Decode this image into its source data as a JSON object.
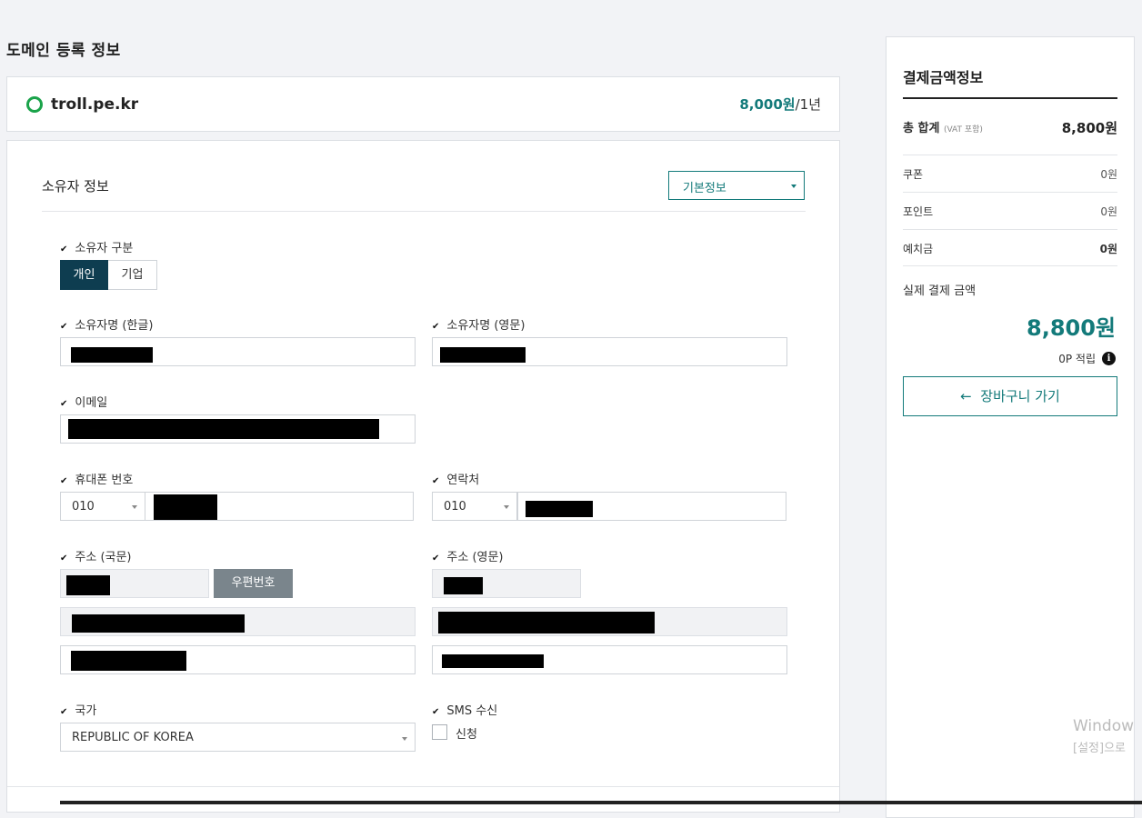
{
  "page_title": "도메인 등록 정보",
  "domain": {
    "name": "troll.pe.kr",
    "price_amount": "8,000원",
    "price_period": "/1년"
  },
  "owner_section": {
    "title": "소유자 정보",
    "info_select": "기본정보",
    "owner_type": {
      "label": "소유자 구분",
      "options": [
        "개인",
        "기업"
      ],
      "selected": "개인"
    },
    "name_kr_label": "소유자명 (한글)",
    "name_en_label": "소유자명 (영문)",
    "email_label": "이메일",
    "mobile": {
      "label": "휴대폰 번호",
      "prefix": "010"
    },
    "contact": {
      "label": "연락처",
      "prefix": "010"
    },
    "address_kr_label": "주소 (국문)",
    "zip_button": "우편번호",
    "address_en_label": "주소 (영문)",
    "country": {
      "label": "국가",
      "value": "REPUBLIC OF KOREA"
    },
    "sms": {
      "label": "SMS 수신",
      "option": "신청",
      "checked": false
    }
  },
  "payment": {
    "title": "결제금액정보",
    "total_label": "총 합계",
    "total_note": "(VAT 포함)",
    "total_value": "8,800원",
    "rows": [
      {
        "label": "쿠폰",
        "value": "0원"
      },
      {
        "label": "포인트",
        "value": "0원"
      },
      {
        "label": "예치금",
        "value": "0원"
      }
    ],
    "actual_label": "실제 결제 금액",
    "actual_value": "8,800원",
    "points_earned": "0P 적립",
    "cart_button": "장바구니 가기",
    "cart_arrow": "←"
  },
  "os_watermark": {
    "line1": "Window",
    "line2": "[설정]으로"
  }
}
